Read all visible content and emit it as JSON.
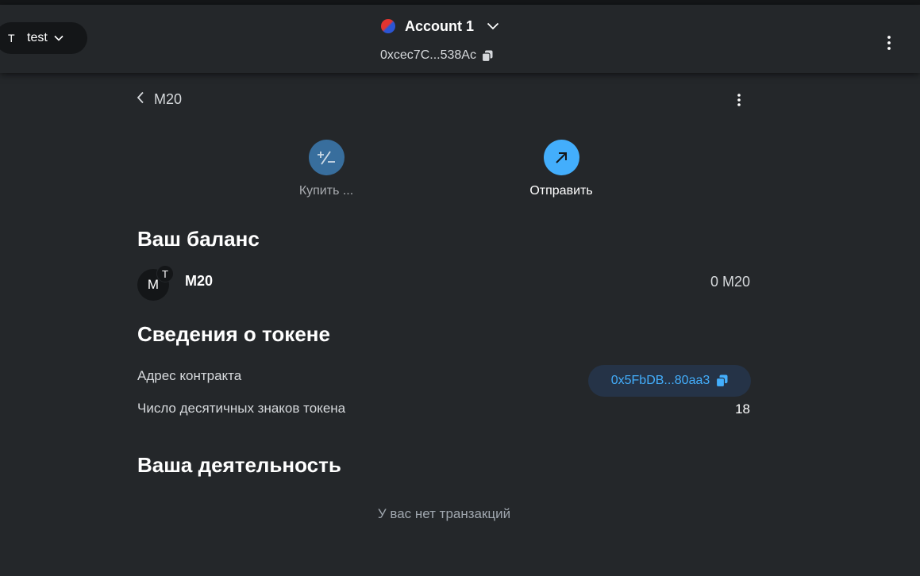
{
  "network": {
    "initial": "T",
    "name": "test"
  },
  "account": {
    "name": "Account 1",
    "address": "0xcec7C...538Ac"
  },
  "token": {
    "symbol": "M20"
  },
  "actions": {
    "buy_label": "Купить ...",
    "send_label": "Отправить"
  },
  "balance": {
    "heading": "Ваш баланс",
    "avatar_letter": "M",
    "badge_letter": "T",
    "token_name": "M20",
    "amount": "0 M20"
  },
  "token_info": {
    "heading": "Сведения о токене",
    "contract_label": "Адрес контракта",
    "contract_address": "0x5FbDB...80aa3",
    "decimals_label": "Число десятичных знаков токена",
    "decimals_value": "18"
  },
  "activity": {
    "heading": "Ваша деятельность",
    "empty_text": "У вас нет транзакций"
  },
  "colors": {
    "background": "#24272a",
    "accent_blue": "#43aefc",
    "buy_button": "#386e9d",
    "pill_dark": "#141618",
    "contract_pill": "#253347"
  }
}
